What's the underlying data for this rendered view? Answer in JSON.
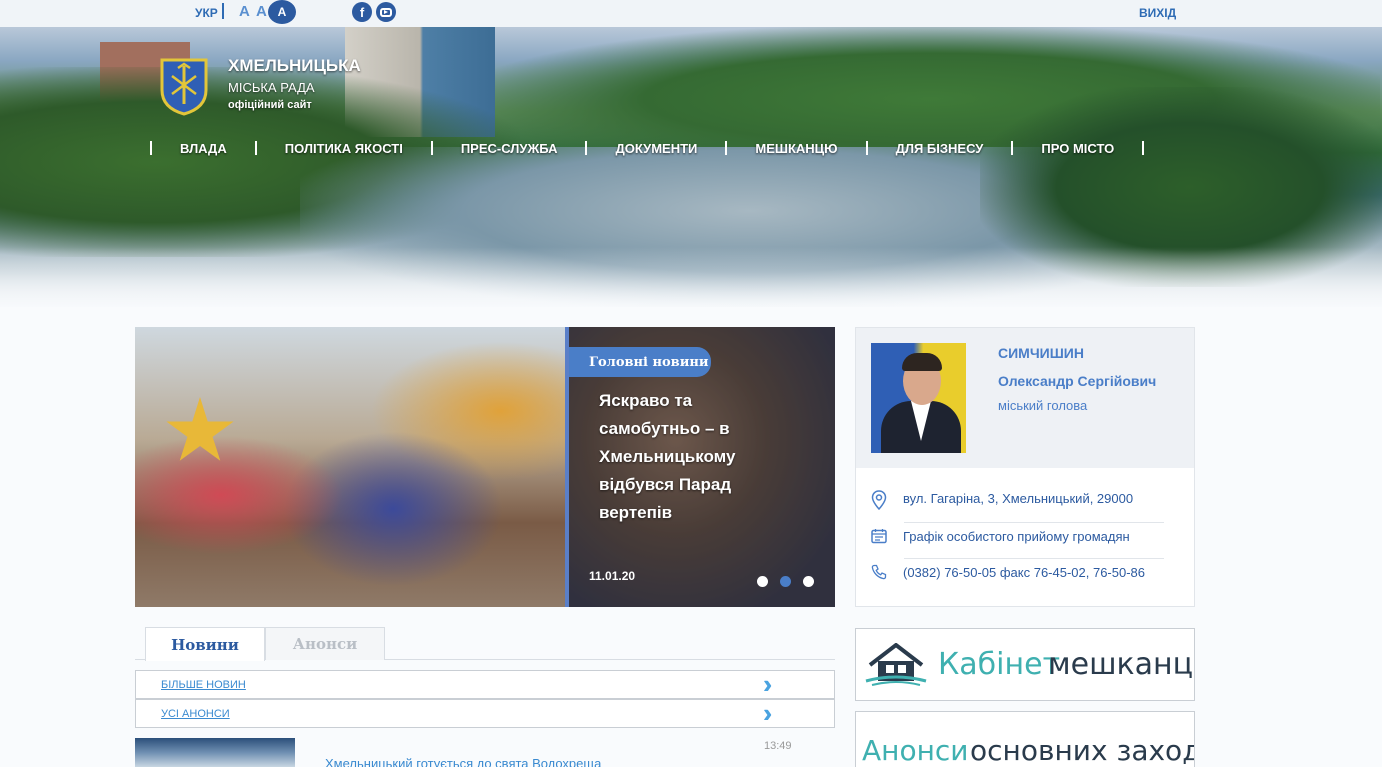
{
  "topbar": {
    "lang": "УКР",
    "font_sizes": [
      "A",
      "A",
      "A"
    ],
    "social": [
      "facebook-icon",
      "youtube-icon"
    ],
    "logout": "ВИХІД"
  },
  "header": {
    "title": "ХМЕЛЬНИЦЬКА",
    "subtitle": "МІСЬКА РАДА",
    "tagline": "офіційний сайт"
  },
  "nav": {
    "items": [
      {
        "label": "ВЛАДА"
      },
      {
        "label": "ПОЛІТИКА ЯКОСТІ"
      },
      {
        "label": "ПРЕС-СЛУЖБА"
      },
      {
        "label": "ДОКУМЕНТИ"
      },
      {
        "label": "МЕШКАНЦЮ"
      },
      {
        "label": "ДЛЯ БІЗНЕСУ"
      },
      {
        "label": "ПРО МІСТО"
      }
    ]
  },
  "slider": {
    "badge": "Головні новини",
    "title": "Яскраво та самобутньо – в Хмельницькому відбувся Парад вертепів",
    "date": "11.01.20",
    "slides_total": 3,
    "active_slide": 2
  },
  "tabs": [
    {
      "label": "Новини",
      "active": true
    },
    {
      "label": "Анонси",
      "active": false
    }
  ],
  "links": {
    "more_news": "БІЛЬШЕ НОВИН",
    "all_announcements": "УСІ АНОНСИ"
  },
  "news": {
    "time": "13:49",
    "title": "Хмельницький готується до свята Водохреща"
  },
  "mayor": {
    "surname": "СИМЧИШИН",
    "name": "Олександр Сергійович",
    "role": "міський голова",
    "address": "вул. Гагаріна, 3, Хмельницький, 29000",
    "schedule": "Графік особистого прийому громадян",
    "phone": "(0382) 76-50-05 факс 76-45-02, 76-50-86"
  },
  "banners": {
    "cabinet_a": "Кабінет",
    "cabinet_b": "мешканця",
    "announce_a": "Анонси",
    "announce_b": "основних заходів"
  },
  "colors": {
    "accent": "#4a7ec8",
    "link": "#3a8ad0",
    "dark_blue": "#2c5aa0",
    "teal": "#3fb0b0"
  }
}
